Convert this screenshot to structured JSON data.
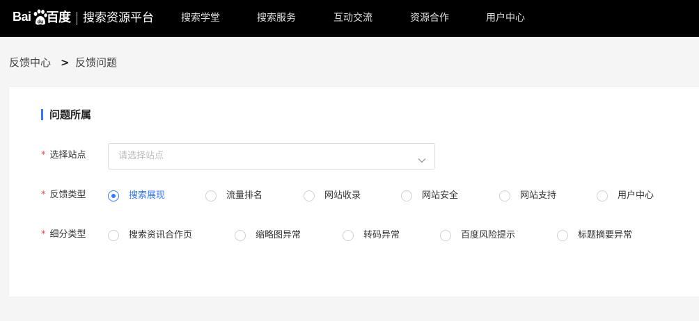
{
  "header": {
    "logo_left": "Bai",
    "logo_right": "百度",
    "subtitle": "搜索资源平台",
    "nav": [
      "搜索学堂",
      "搜索服务",
      "互动交流",
      "资源合作",
      "用户中心"
    ]
  },
  "breadcrumb": {
    "root": "反馈中心",
    "separator": ">",
    "current": "反馈问题"
  },
  "section": {
    "title": "问题所属"
  },
  "form": {
    "required_mark": "*",
    "site": {
      "label": "选择站点",
      "placeholder": "请选择站点"
    },
    "feedback_type": {
      "label": "反馈类型",
      "options": [
        "搜索展现",
        "流量排名",
        "网站收录",
        "网站安全",
        "网站支持",
        "用户中心"
      ],
      "selected": "搜索展现"
    },
    "sub_type": {
      "label": "细分类型",
      "options": [
        "搜索资讯合作页",
        "缩略图异常",
        "转码异常",
        "百度风险提示",
        "标题摘要异常"
      ],
      "selected": ""
    }
  },
  "colors": {
    "accent": "#3377ff",
    "required": "#e64552",
    "topbar": "#000000",
    "page_bg": "#f5f5f5"
  }
}
